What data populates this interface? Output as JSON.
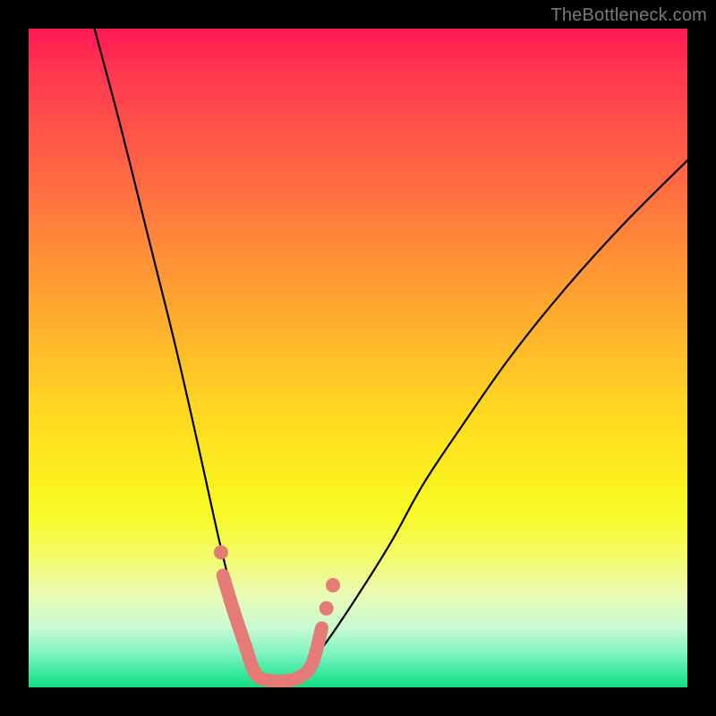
{
  "watermark": "TheBottleneck.com",
  "chart_data": {
    "type": "line",
    "title": "",
    "xlabel": "",
    "ylabel": "",
    "xlim": [
      0,
      100
    ],
    "ylim": [
      0,
      100
    ],
    "grid": false,
    "series": [
      {
        "name": "bottleneck-curve",
        "color": "#000000",
        "x": [
          10,
          14,
          18,
          22,
          25,
          27,
          29,
          31,
          33,
          34,
          35,
          37,
          39,
          41,
          43,
          46,
          50,
          55,
          60,
          66,
          73,
          81,
          90,
          100
        ],
        "y": [
          100,
          85,
          69,
          53,
          40,
          31,
          22,
          14,
          7,
          4,
          2,
          1,
          1,
          2,
          4,
          8,
          14,
          22,
          31,
          40,
          50,
          60,
          70,
          80
        ]
      },
      {
        "name": "highlight-bottom",
        "color": "#e47b77",
        "x": [
          29.5,
          31,
          33,
          34,
          35,
          37,
          39,
          41,
          43,
          44.5
        ],
        "y": [
          17,
          12,
          6,
          3,
          1.5,
          1,
          1,
          1.5,
          3.5,
          9
        ]
      },
      {
        "name": "highlight-dot-left",
        "color": "#e47b77",
        "x": [
          29.2
        ],
        "y": [
          20.5
        ]
      },
      {
        "name": "highlight-dot-right-1",
        "color": "#e47b77",
        "x": [
          45.2
        ],
        "y": [
          12
        ]
      },
      {
        "name": "highlight-dot-right-2",
        "color": "#e47b77",
        "x": [
          46.2
        ],
        "y": [
          15.5
        ]
      }
    ]
  }
}
